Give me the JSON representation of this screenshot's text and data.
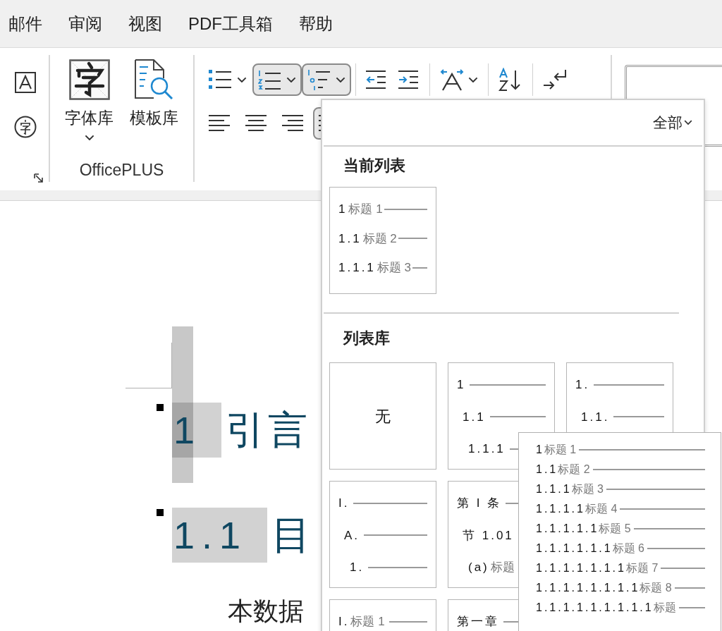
{
  "menu_tabs": [
    "邮件",
    "审阅",
    "视图",
    "PDF工具箱",
    "帮助"
  ],
  "ribbon": {
    "officeplus": {
      "buttons": [
        {
          "kind": "font_library",
          "label": "字体库",
          "has_dropdown": true
        },
        {
          "kind": "template_library",
          "label": "模板库"
        }
      ],
      "group_label": "OfficePLUS"
    },
    "paragraph_row_1": [
      {
        "kind": "bullets",
        "selected": false,
        "has_dropdown": true
      },
      {
        "kind": "numbering",
        "selected": true,
        "has_dropdown": true
      },
      {
        "kind": "multilevel",
        "selected": true,
        "has_dropdown": true
      },
      {
        "kind": "separator"
      },
      {
        "kind": "outdent",
        "selected": false
      },
      {
        "kind": "indent",
        "selected": false
      },
      {
        "kind": "separator"
      },
      {
        "kind": "asian_layout",
        "selected": false,
        "has_dropdown": true
      },
      {
        "kind": "separator"
      },
      {
        "kind": "sort",
        "selected": false
      },
      {
        "kind": "separator"
      },
      {
        "kind": "line_break",
        "selected": false
      }
    ],
    "paragraph_row_2": [
      {
        "kind": "align_left",
        "selected": false
      },
      {
        "kind": "align_center",
        "selected": false
      },
      {
        "kind": "align_right",
        "selected": false
      },
      {
        "kind": "justify",
        "selected": true
      }
    ]
  },
  "document": {
    "headings": [
      {
        "number": "1",
        "text": "引言",
        "selected": true
      },
      {
        "number": "1.1",
        "text": "目",
        "selected": false
      }
    ],
    "body": "本数据"
  },
  "list_dropdown": {
    "filter": "全部",
    "current_title": "当前列表",
    "current_lists": [
      {
        "lines": [
          {
            "number": "1",
            "label": "标题 1"
          },
          {
            "number": "1.1",
            "label": "标题 2"
          },
          {
            "number": "1.1.1",
            "label": "标题 3"
          }
        ]
      }
    ],
    "library_title": "列表库",
    "library_rows": [
      [
        {
          "kind": "none",
          "label": "无"
        },
        {
          "kind": "lines",
          "lines": [
            {
              "number": "1"
            },
            {
              "number": "1.1"
            },
            {
              "number": "1.1.1"
            }
          ]
        },
        {
          "kind": "lines",
          "lines": [
            {
              "number": "1."
            },
            {
              "number": "1.1."
            }
          ]
        }
      ],
      [
        {
          "kind": "lines",
          "lines": [
            {
              "number": "I."
            },
            {
              "number": "A."
            },
            {
              "number": "1."
            }
          ]
        },
        {
          "kind": "lines",
          "lines": [
            {
              "number": "第 I 条"
            },
            {
              "number": "节 1.01"
            },
            {
              "number": "(a)",
              "label": "标题"
            }
          ]
        }
      ],
      [
        {
          "kind": "lines",
          "lines": [
            {
              "number": "I.",
              "label": "标题 1"
            }
          ]
        },
        {
          "kind": "lines",
          "lines": [
            {
              "number": "第一章"
            }
          ]
        }
      ]
    ]
  },
  "preview": {
    "lines": [
      {
        "number": "1",
        "label": "标题 1"
      },
      {
        "number": "1.1",
        "label": "标题 2"
      },
      {
        "number": "1.1.1",
        "label": "标题 3"
      },
      {
        "number": "1.1.1.1",
        "label": "标题 4"
      },
      {
        "number": "1.1.1.1.1",
        "label": "标题 5"
      },
      {
        "number": "1.1.1.1.1.1",
        "label": "标题 6"
      },
      {
        "number": "1.1.1.1.1.1.1",
        "label": "标题 7"
      },
      {
        "number": "1.1.1.1.1.1.1.1",
        "label": "标题 8"
      },
      {
        "number": "1.1.1.1.1.1.1.1.1",
        "label": "标题"
      }
    ]
  }
}
